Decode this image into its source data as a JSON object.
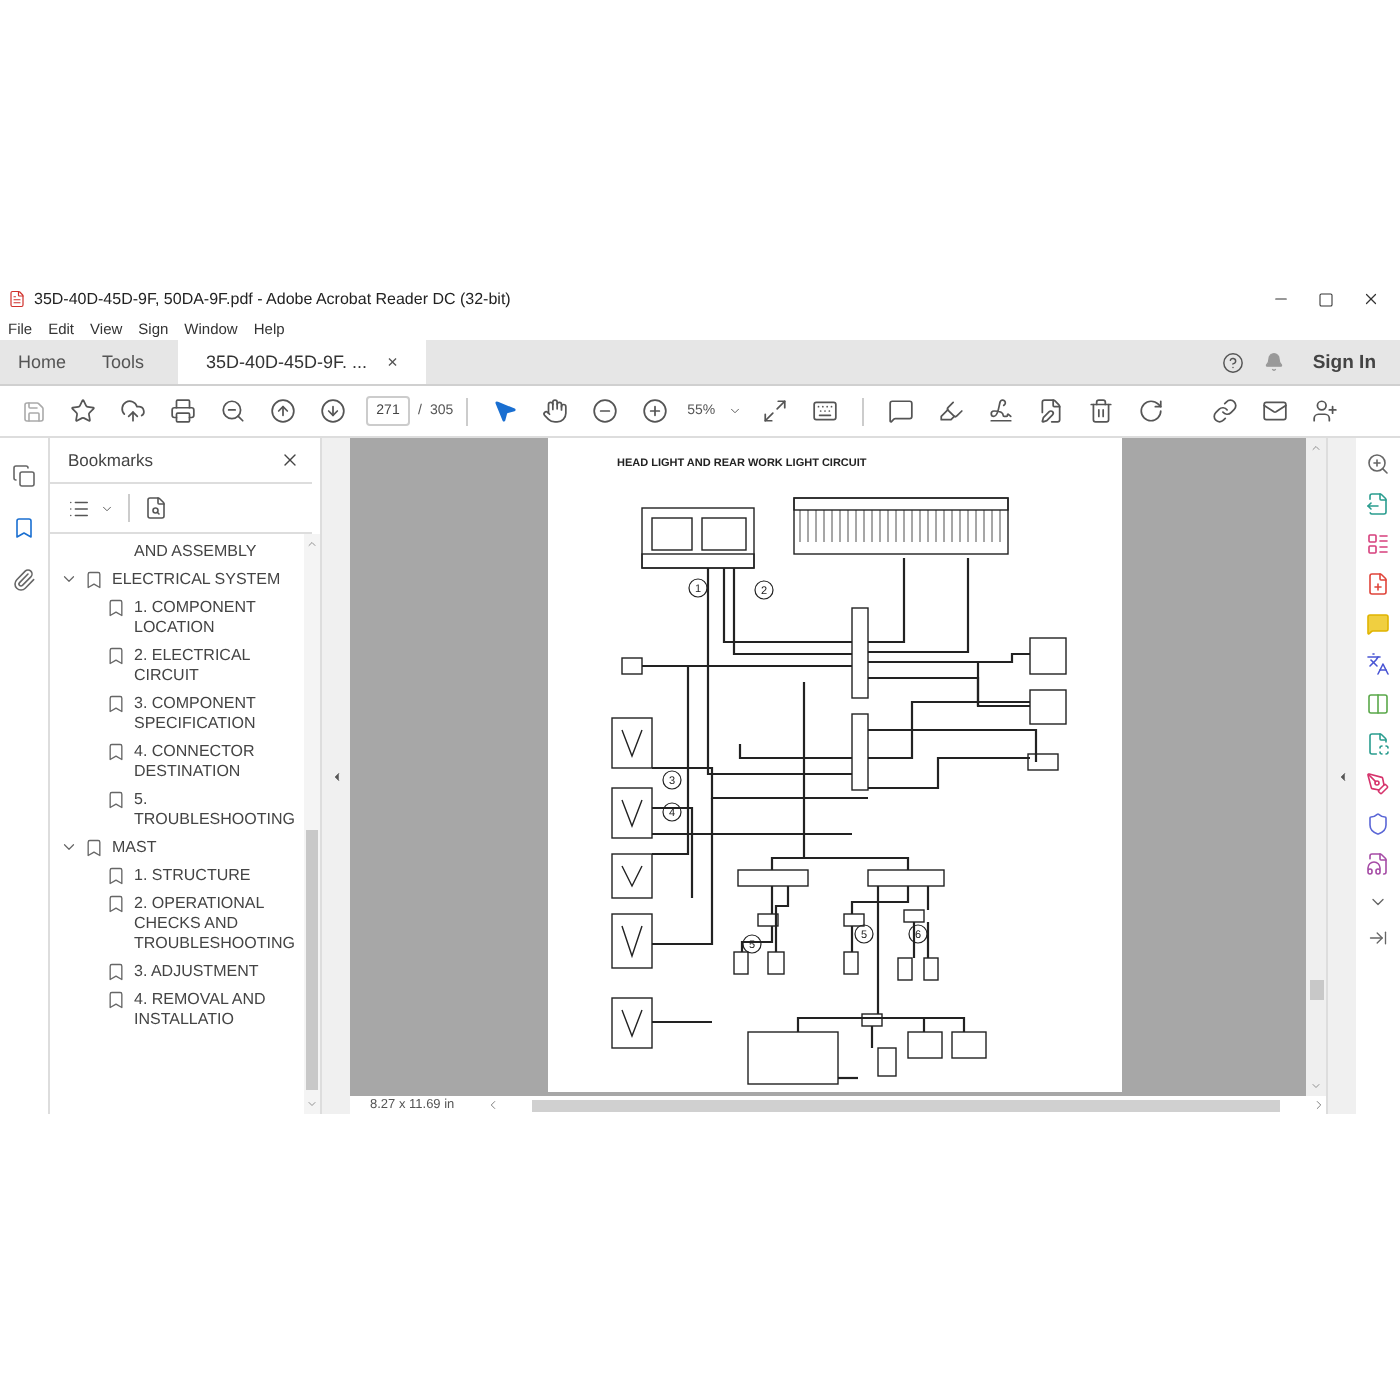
{
  "window": {
    "title": "35D-40D-45D-9F, 50DA-9F.pdf - Adobe Acrobat Reader DC (32-bit)"
  },
  "menu": [
    {
      "label": "File"
    },
    {
      "label": "Edit"
    },
    {
      "label": "View"
    },
    {
      "label": "Sign"
    },
    {
      "label": "Window"
    },
    {
      "label": "Help"
    }
  ],
  "tabs": [
    {
      "label": "Home",
      "selected": false
    },
    {
      "label": "Tools",
      "selected": false
    },
    {
      "label": "35D-40D-45D-9F. ...",
      "selected": true,
      "close": "×"
    }
  ],
  "account": {
    "sign_in": "Sign In"
  },
  "toolbar": {
    "page": "271",
    "separator": "/",
    "page_count": "305",
    "zoom": "55%"
  },
  "panels": [
    {
      "kind": "pages",
      "selected": false
    },
    {
      "kind": "bookmarks",
      "selected": true
    },
    {
      "kind": "attachments",
      "selected": false
    }
  ],
  "bookmarks": {
    "title": "Bookmarks",
    "items": [
      {
        "kind": "fragment",
        "label": "AND ASSEMBLY"
      },
      {
        "kind": "folder",
        "label": "ELECTRICAL SYSTEM",
        "expanded": true,
        "children": [
          {
            "kind": "leaf",
            "label": "1. COMPONENT LOCATION"
          },
          {
            "kind": "leaf",
            "label": "2. ELECTRICAL CIRCUIT"
          },
          {
            "kind": "leaf",
            "label": "3. COMPONENT SPECIFICATION"
          },
          {
            "kind": "leaf",
            "label": "4. CONNECTOR DESTINATION"
          },
          {
            "kind": "leaf",
            "label": "5. TROUBLESHOOTING"
          }
        ]
      },
      {
        "kind": "folder",
        "label": "MAST",
        "expanded": true,
        "children": [
          {
            "kind": "leaf",
            "label": "1. STRUCTURE"
          },
          {
            "kind": "leaf",
            "label": "2. OPERATIONAL CHECKS AND TROUBLESHOOTING"
          },
          {
            "kind": "leaf",
            "label": "3. ADJUSTMENT"
          },
          {
            "kind": "leaf",
            "label": "4. REMOVAL AND INSTALLATIO"
          }
        ]
      }
    ]
  },
  "document": {
    "title": "HEAD LIGHT AND REAR WORK LIGHT CIRCUIT",
    "callouts": [
      "1",
      "2",
      "3",
      "4",
      "5",
      "5",
      "6"
    ]
  },
  "status_bar": {
    "page_size": "8.27 x 11.69 in"
  }
}
